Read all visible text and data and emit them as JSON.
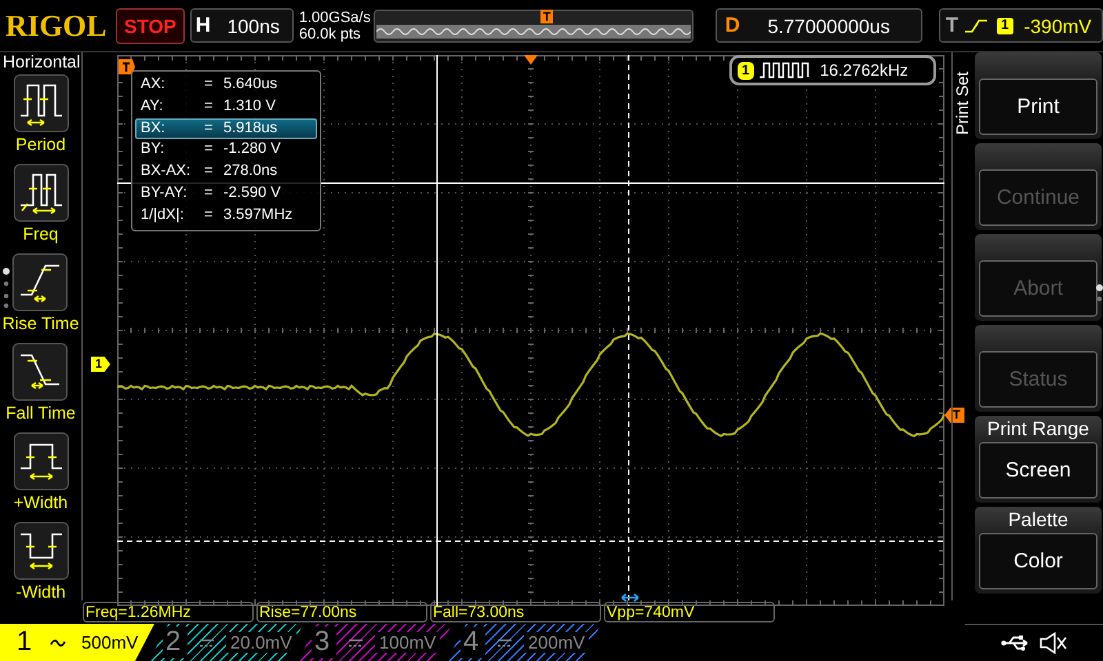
{
  "top_bar": {
    "brand": "RIGOL",
    "run_state": "STOP",
    "horizontal": {
      "label": "H",
      "timebase": "100ns"
    },
    "sample": {
      "rate": "1.00GSa/s",
      "points": "60.0k pts"
    },
    "memory_trigger_marker": "T",
    "delay": {
      "label": "D",
      "value": "5.77000000us"
    },
    "trigger": {
      "label": "T",
      "source": "1",
      "level": "-390mV"
    }
  },
  "left_menu": {
    "title": "Horizontal",
    "items": [
      {
        "kind": "period",
        "label": "Period"
      },
      {
        "kind": "freq",
        "label": "Freq"
      },
      {
        "kind": "rise",
        "label": "Rise Time"
      },
      {
        "kind": "fall",
        "label": "Fall Time"
      },
      {
        "kind": "pwidth",
        "label": "+Width"
      },
      {
        "kind": "nwidth",
        "label": "-Width"
      }
    ]
  },
  "display": {
    "channel_marker": "1",
    "trigger_level_marker": "T",
    "cursor_readout": [
      {
        "label": "AX:",
        "sign": "=",
        "value": "5.640us",
        "selected": false
      },
      {
        "label": "AY:",
        "sign": "=",
        "value": "1.310 V",
        "selected": false
      },
      {
        "label": "BX:",
        "sign": "=",
        "value": "5.918us",
        "selected": true
      },
      {
        "label": "BY:",
        "sign": "=",
        "value": "-1.280 V",
        "selected": false
      },
      {
        "label": "BX-AX:",
        "sign": "=",
        "value": "278.0ns",
        "selected": false
      },
      {
        "label": "BY-AY:",
        "sign": "=",
        "value": "-2.590 V",
        "selected": false
      },
      {
        "label": "1/|dX|:",
        "sign": "=",
        "value": "3.597MHz",
        "selected": false
      }
    ],
    "frequency_counter": {
      "channel": "1",
      "value": "16.2762kHz"
    }
  },
  "right_menu": {
    "title": "Print Set",
    "buttons": [
      {
        "label": "Print",
        "disabled": false
      },
      {
        "label": "Continue",
        "disabled": true
      },
      {
        "label": "Abort",
        "disabled": true
      },
      {
        "label": "Status",
        "disabled": true
      },
      {
        "heading": "Print Range",
        "label": "Screen",
        "disabled": false
      },
      {
        "heading": "Palette",
        "label": "Color",
        "disabled": false
      }
    ]
  },
  "measurements": [
    "Freq=1.26MHz",
    "Rise=77.00ns",
    "Fall=73.00ns",
    "Vpp=740mV"
  ],
  "channels": [
    {
      "number": "1",
      "kind": "ac",
      "scale": "500mV",
      "on": true,
      "color": "#ffff00"
    },
    {
      "number": "2",
      "kind": "dc",
      "scale": "20.0mV",
      "on": false,
      "color": "#00c8c8"
    },
    {
      "number": "3",
      "kind": "dc",
      "scale": "100mV",
      "on": false,
      "color": "#c800c8"
    },
    {
      "number": "4",
      "kind": "dc",
      "scale": "200mV",
      "on": false,
      "color": "#2878ff"
    }
  ]
}
